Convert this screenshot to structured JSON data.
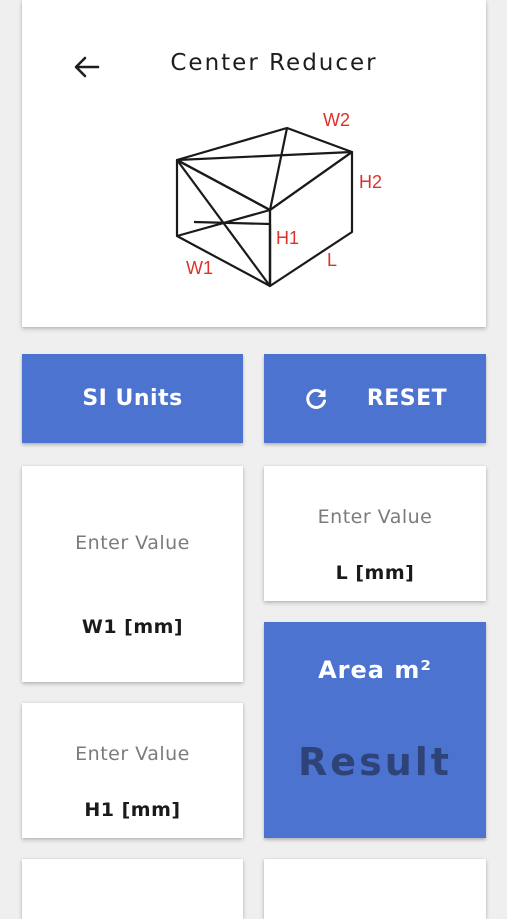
{
  "header": {
    "title": "Center Reducer",
    "back_icon": "arrow-left-icon"
  },
  "diagram": {
    "labels": {
      "w2": "W2",
      "h2": "H2",
      "h1": "H1",
      "l": "L",
      "w1": "W1"
    },
    "label_color": "#e0302a"
  },
  "buttons": {
    "units_label": "SI Units",
    "reset_label": "RESET",
    "reset_icon": "refresh-icon"
  },
  "inputs": {
    "w1": {
      "placeholder": "Enter Value",
      "label": "W1 [mm]"
    },
    "l": {
      "placeholder": "Enter Value",
      "label": "L [mm]"
    },
    "h1": {
      "placeholder": "Enter Value",
      "label": "H1 [mm]"
    }
  },
  "result": {
    "title": "Area m²",
    "value": "Result"
  },
  "colors": {
    "accent": "#4c73cf",
    "result_text": "#2e4377",
    "background": "#efefef"
  }
}
